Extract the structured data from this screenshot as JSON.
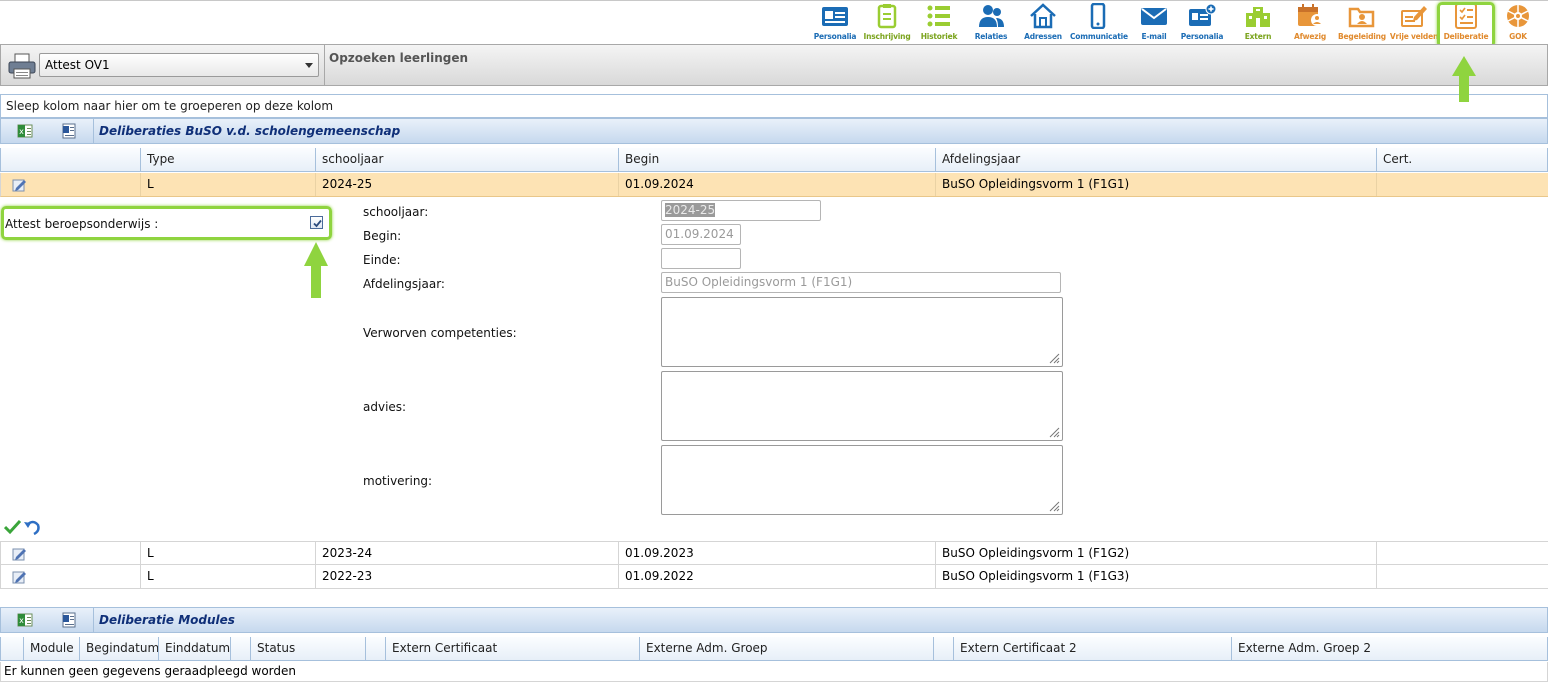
{
  "toolbar": {
    "items": [
      {
        "label": "Personalia",
        "icon": "id-card-icon",
        "color": "blue"
      },
      {
        "label": "Inschrijving",
        "icon": "clipboard-icon",
        "color": "lime"
      },
      {
        "label": "Historiek",
        "icon": "list-icon",
        "color": "lime"
      },
      {
        "label": "Relaties",
        "icon": "people-icon",
        "color": "blue"
      },
      {
        "label": "Adressen",
        "icon": "house-icon",
        "color": "blue"
      },
      {
        "label": "Communicatie",
        "icon": "phone-icon",
        "color": "blue"
      },
      {
        "label": "E-mail",
        "icon": "envelope-icon",
        "color": "blue"
      },
      {
        "label": "Personalia",
        "icon": "id-card-plus-icon",
        "color": "blue"
      },
      {
        "label": "Extern",
        "icon": "building-icon",
        "color": "lime"
      },
      {
        "label": "Afwezig",
        "icon": "calendar-person-icon",
        "color": "orange"
      },
      {
        "label": "Begeleiding",
        "icon": "folder-person-icon",
        "color": "orange"
      },
      {
        "label": "Vrije velden",
        "icon": "pencil-form-icon",
        "color": "orange"
      },
      {
        "label": "Deliberatie",
        "icon": "checklist-icon",
        "color": "orange"
      },
      {
        "label": "GOK",
        "icon": "gok-icon",
        "color": "orange"
      }
    ]
  },
  "header": {
    "report_select": "Attest OV1",
    "title": "Opzoeken leerlingen"
  },
  "grid1": {
    "group_hint": "Sleep kolom naar hier om te groeperen op deze kolom",
    "title": "Deliberaties BuSO v.d. scholengemeenschap",
    "columns": [
      "Type",
      "schooljaar",
      "Begin",
      "Afdelingsjaar",
      "Cert."
    ],
    "rows": [
      {
        "type": "L",
        "schooljaar": "2024-25",
        "begin": "01.09.2024",
        "afdelingsjaar": "BuSO Opleidingsvorm 1 (F1G1)",
        "cert": ""
      },
      {
        "type": "L",
        "schooljaar": "2023-24",
        "begin": "01.09.2023",
        "afdelingsjaar": "BuSO Opleidingsvorm 1 (F1G2)",
        "cert": ""
      },
      {
        "type": "L",
        "schooljaar": "2022-23",
        "begin": "01.09.2022",
        "afdelingsjaar": "BuSO Opleidingsvorm 1 (F1G3)",
        "cert": ""
      }
    ]
  },
  "detail": {
    "attest_label": "Attest beroepsonderwijs :",
    "attest_checked": true,
    "schooljaar_label": "schooljaar:",
    "schooljaar_value": "2024-25",
    "begin_label": "Begin:",
    "begin_value": "01.09.2024",
    "einde_label": "Einde:",
    "einde_value": "",
    "afdelingsjaar_label": "Afdelingsjaar:",
    "afdelingsjaar_value": "BuSO Opleidingsvorm 1 (F1G1)",
    "competenties_label": "Verworven competenties:",
    "advies_label": "advies:",
    "motivering_label": "motivering:"
  },
  "grid2": {
    "title": "Deliberatie Modules",
    "columns": [
      "Module",
      "Begindatum",
      "Einddatum",
      "Status",
      "Extern Certificaat",
      "Externe Adm. Groep",
      "Extern Certificaat 2",
      "Externe Adm. Groep 2"
    ],
    "empty_message": "Er kunnen geen gegevens geraadpleegd worden"
  },
  "colors": {
    "highlight": "#8fd43f",
    "selected_row": "#fde3b4",
    "grid_title": "#0f2f78"
  }
}
